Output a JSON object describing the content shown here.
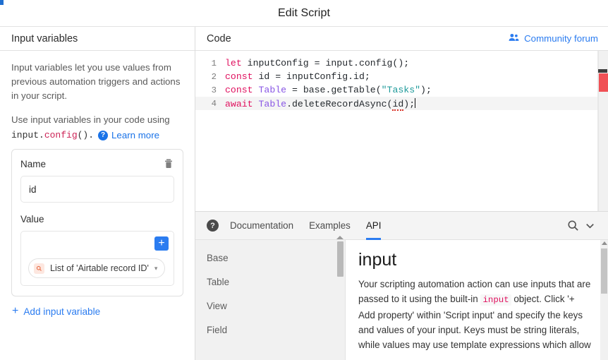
{
  "window": {
    "title": "Edit Script"
  },
  "left_pane": {
    "header": "Input variables",
    "paragraph_1": "Input variables let you use values from previous automation triggers and actions in your script.",
    "paragraph_2": "Use input variables in your code using",
    "code_prefix": "input.",
    "code_highlight": "config",
    "code_suffix": "().",
    "help_icon_glyph": "?",
    "learn_more": "Learn more",
    "variable_card": {
      "name_label": "Name",
      "delete_icon": "trash-icon",
      "name_value": "id",
      "value_label": "Value",
      "add_button_glyph": "+",
      "chip_icon": "magnifier-field-icon",
      "chip_text": "List of 'Airtable record ID'",
      "chip_caret": "▾"
    },
    "add_input_variable": "Add input variable",
    "add_glyph": "+"
  },
  "code_pane": {
    "header": "Code",
    "community_forum": "Community forum",
    "community_icon": "people-icon",
    "lines": [
      {
        "number": "1",
        "current": false,
        "tokens": [
          {
            "t": "let",
            "c": "kw"
          },
          {
            "t": " inputConfig = input.config();",
            "c": "plain"
          }
        ]
      },
      {
        "number": "2",
        "current": false,
        "tokens": [
          {
            "t": "const",
            "c": "kw"
          },
          {
            "t": " id = inputConfig.id;",
            "c": "plain"
          }
        ]
      },
      {
        "number": "3",
        "current": false,
        "tokens": [
          {
            "t": "const",
            "c": "kw"
          },
          {
            "t": " ",
            "c": "plain"
          },
          {
            "t": "Table",
            "c": "type"
          },
          {
            "t": " = base.getTable(",
            "c": "plain"
          },
          {
            "t": "\"Tasks\"",
            "c": "str"
          },
          {
            "t": ");",
            "c": "plain"
          }
        ]
      },
      {
        "number": "4",
        "current": true,
        "tokens": [
          {
            "t": "await",
            "c": "kw"
          },
          {
            "t": " ",
            "c": "plain"
          },
          {
            "t": "Table",
            "c": "type"
          },
          {
            "t": ".deleteRecordAsync(",
            "c": "plain"
          },
          {
            "t": "id",
            "c": "err"
          },
          {
            "t": ");",
            "c": "plain"
          }
        ]
      }
    ],
    "error_marker_color": "#f05055"
  },
  "docs_panel": {
    "help_icon_glyph": "?",
    "tabs": [
      {
        "label": "Documentation",
        "active": false
      },
      {
        "label": "Examples",
        "active": false
      },
      {
        "label": "API",
        "active": true
      }
    ],
    "search_icon": "search-icon",
    "collapse_icon": "chevron-down-icon",
    "nav_items": [
      "Base",
      "Table",
      "View",
      "Field"
    ],
    "content": {
      "heading": "input",
      "text_part_1": "Your scripting automation action can use inputs that are passed to it using the built-in ",
      "inline_code": "input",
      "text_part_2": " object. Click '+ Add property' within 'Script input' and specify the keys and values of your input. Keys must be string literals, while values may use template expressions which allow"
    }
  },
  "colors": {
    "accent_blue": "#2b7cf0",
    "link_blue": "#1a73e8",
    "keyword_pink": "#e0115f",
    "type_purple": "#8957e5",
    "string_teal": "#1d9a9a",
    "error_red": "#f05055",
    "chip_orange": "#fde7e0"
  }
}
